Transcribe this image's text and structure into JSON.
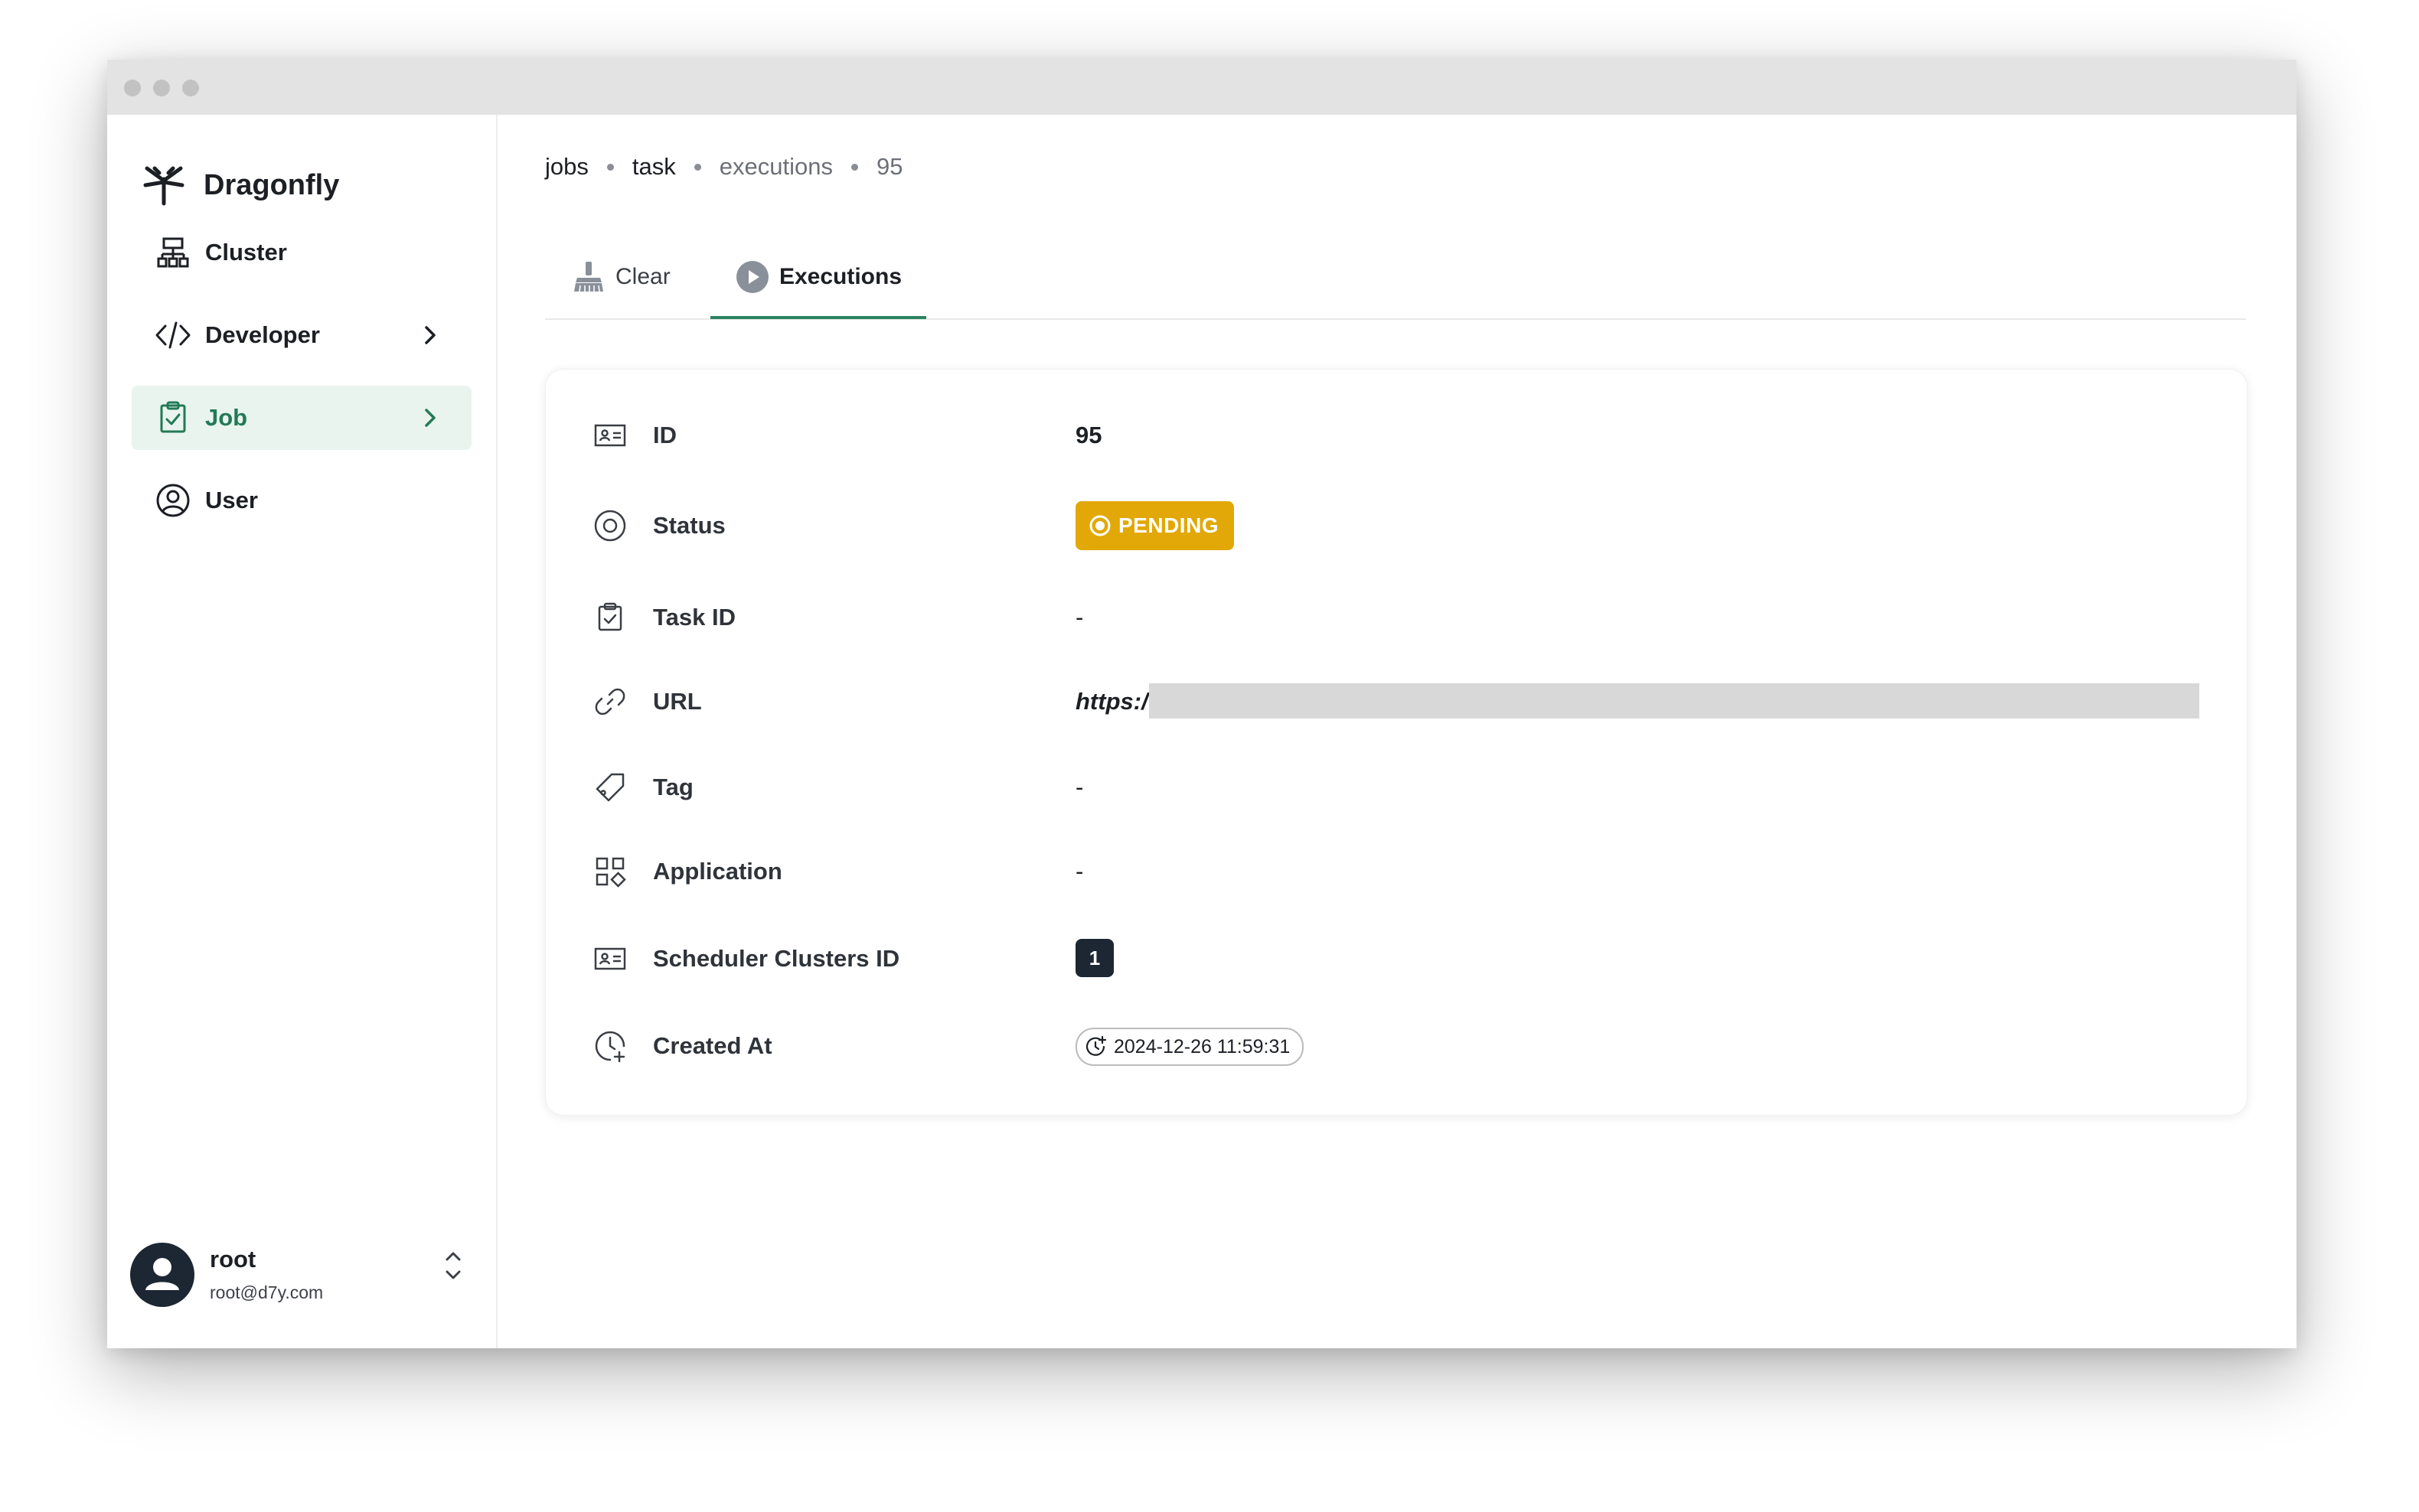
{
  "app": {
    "name": "Dragonfly"
  },
  "sidebar": {
    "items": [
      {
        "label": "Cluster",
        "icon": "cluster-icon"
      },
      {
        "label": "Developer",
        "icon": "code-icon"
      },
      {
        "label": "Job",
        "icon": "clipboard-check-icon",
        "active": true
      },
      {
        "label": "User",
        "icon": "user-circle-icon"
      }
    ]
  },
  "user": {
    "name": "root",
    "email": "root@d7y.com"
  },
  "breadcrumb": [
    "jobs",
    "task",
    "executions",
    "95"
  ],
  "tabs": [
    {
      "label": "Clear",
      "icon": "broom-icon"
    },
    {
      "label": "Executions",
      "icon": "play-circle-icon",
      "active": true
    }
  ],
  "details": {
    "id": {
      "label": "ID",
      "value": "95"
    },
    "status": {
      "label": "Status",
      "value": "PENDING",
      "color": "#e2a808"
    },
    "task_id": {
      "label": "Task ID",
      "value": "-"
    },
    "url": {
      "label": "URL",
      "value": "https:/"
    },
    "tag": {
      "label": "Tag",
      "value": "-"
    },
    "application": {
      "label": "Application",
      "value": "-"
    },
    "scheduler_clusters_id": {
      "label": "Scheduler Clusters ID",
      "value": "1"
    },
    "created_at": {
      "label": "Created At",
      "value": "2024-12-26 11:59:31"
    }
  },
  "colors": {
    "accent": "#2a8461",
    "active_bg": "#eaf4ef",
    "pending": "#e2a808",
    "dark": "#1c2733"
  }
}
